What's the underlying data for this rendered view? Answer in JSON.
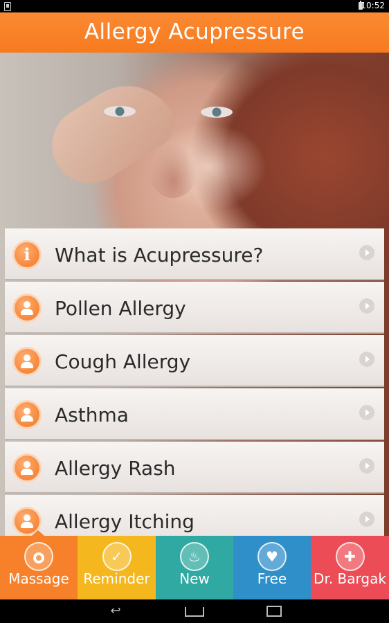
{
  "status_bar": {
    "time": "10:52"
  },
  "header": {
    "title": "Allergy Acupressure"
  },
  "list": {
    "items": [
      {
        "label": "What is Acupressure?",
        "icon": "info-icon"
      },
      {
        "label": "Pollen Allergy",
        "icon": "person-icon"
      },
      {
        "label": "Cough Allergy",
        "icon": "person-icon"
      },
      {
        "label": "Asthma",
        "icon": "person-icon"
      },
      {
        "label": "Allergy Rash",
        "icon": "person-icon"
      },
      {
        "label": "Allergy Itching",
        "icon": "person-icon"
      }
    ]
  },
  "tabs": [
    {
      "label": "Massage",
      "icon": "target-icon",
      "color": "#f7802a",
      "selected": true
    },
    {
      "label": "Reminder",
      "icon": "watch-icon",
      "color": "#f4b71e"
    },
    {
      "label": "New",
      "icon": "flame-icon",
      "color": "#2fa9a1"
    },
    {
      "label": "Free",
      "icon": "phone-heart-icon",
      "color": "#2f8fc9"
    },
    {
      "label": "Dr. Bargak",
      "icon": "doctor-icon",
      "color": "#ec4c56"
    }
  ],
  "colors": {
    "header": "#f7802a",
    "item_text": "#2a2a2a"
  }
}
